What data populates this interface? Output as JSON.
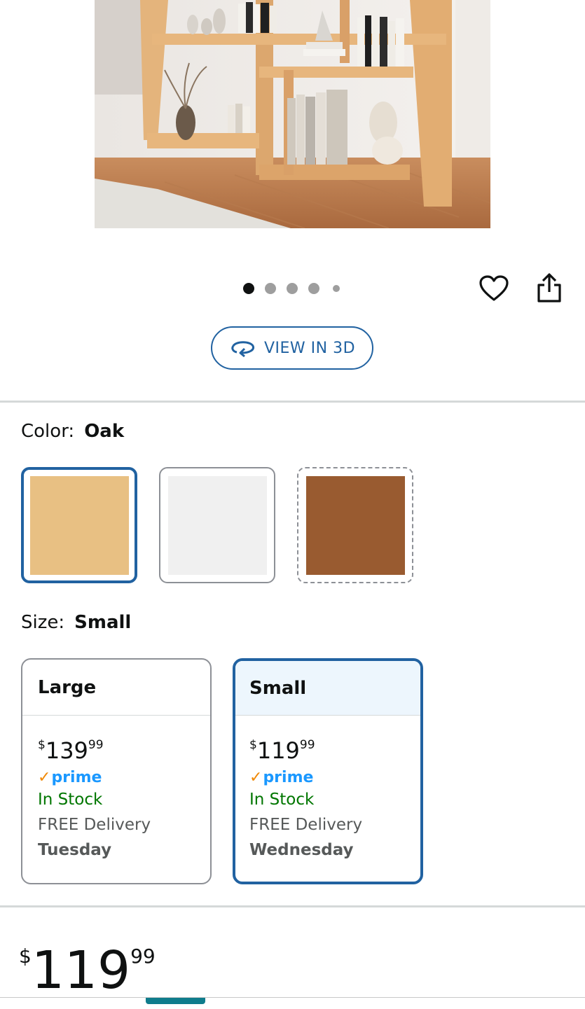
{
  "product": {
    "image_alt": "Oak wooden bookshelf with books and decor"
  },
  "carousel": {
    "total_dots": 5,
    "active_index": 0
  },
  "actions": {
    "wishlist_icon": "heart-icon",
    "share_icon": "share-icon"
  },
  "view3d": {
    "label": "VIEW IN 3D",
    "icon": "rotate-3d-icon",
    "color": "#2162a1"
  },
  "color_selector": {
    "label": "Color:",
    "selected": "Oak",
    "swatches": [
      {
        "name": "Oak",
        "color": "#e8c083",
        "selected": true
      },
      {
        "name": "White",
        "color": "#f0f0f0",
        "selected": false
      },
      {
        "name": "Walnut",
        "color": "#995b30",
        "selected": false,
        "unavailable": true
      }
    ]
  },
  "size_selector": {
    "label": "Size:",
    "selected": "Small",
    "options": [
      {
        "name": "Large",
        "price_dollars": "139",
        "price_cents": "99",
        "prime": "prime",
        "stock": "In Stock",
        "delivery": "FREE Delivery",
        "day": "Tuesday",
        "selected": false
      },
      {
        "name": "Small",
        "price_dollars": "119",
        "price_cents": "99",
        "prime": "prime",
        "stock": "In Stock",
        "delivery": "FREE Delivery",
        "day": "Wednesday",
        "selected": true
      }
    ]
  },
  "price": {
    "currency": "$",
    "dollars": "119",
    "cents": "99"
  },
  "colors": {
    "accent": "#2162a1",
    "in_stock": "#007600",
    "prime": "#1a98ff",
    "divider": "#d5d9d9"
  }
}
